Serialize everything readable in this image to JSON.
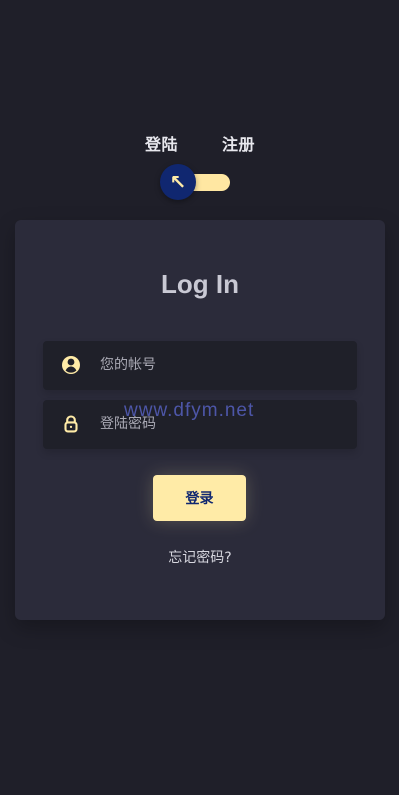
{
  "mode_toggle": {
    "login_label": "登陆",
    "register_label": "注册",
    "knob_arrow": "↖",
    "selected": "login"
  },
  "login_form": {
    "title": "Log In",
    "username": {
      "placeholder": "您的帐号",
      "value": "",
      "icon": "user-circle-icon"
    },
    "password": {
      "placeholder": "登陆密码",
      "value": "",
      "icon": "lock-icon"
    },
    "submit_label": "登录",
    "forgot_label": "忘记密码?"
  },
  "watermark": "www.dfym.net",
  "colors": {
    "background": "#1f1f29",
    "card": "#2b2b3a",
    "accent": "#ffeba7",
    "knob": "#102770",
    "input": "#1f2029",
    "watermark": "#4d56a8"
  }
}
